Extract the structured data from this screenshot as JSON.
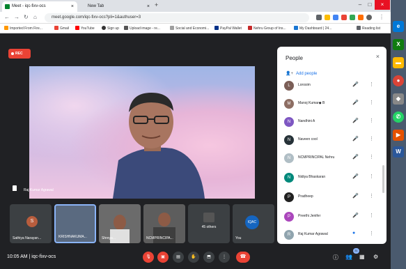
{
  "browser": {
    "tabs": [
      {
        "title": "Meet - iqc-fixv-ocs",
        "close": "×",
        "active": true
      },
      {
        "title": "New Tab",
        "close": "×",
        "active": false
      }
    ],
    "new_tab": "+",
    "window_controls": [
      "–",
      "□",
      "×"
    ],
    "url": "meet.google.com/iqc-fixv-ocs?pli=1&authuser=3",
    "bookmarks": [
      "Imported From Fire...",
      "Gmail",
      "YouTube",
      "Sign up",
      "Upload image - re...",
      "Social and Economi...",
      "PayPal Wallet",
      "Nehru Group of Ins...",
      "My Dashboard | 24...",
      "Reading list"
    ]
  },
  "meet": {
    "rec_label": "REC",
    "presenter_name": "Raj Kumar Agrawal",
    "tiles": [
      {
        "name": "Sathiya Narayan...",
        "initial": "S"
      },
      {
        "name": "KRISHNAKUMA..."
      },
      {
        "name": "Shreya..."
      },
      {
        "name": "NCMPRINCIPA..."
      },
      {
        "name": "45 others"
      },
      {
        "name": "You",
        "badge": "IQAC"
      }
    ],
    "time_meeting": "10:05 AM | iqc-fixv-ocs",
    "people_badge": "31"
  },
  "people_panel": {
    "title": "People",
    "close": "×",
    "add_people": "Add people",
    "participants": [
      {
        "name": "Lorosim",
        "initial": "L",
        "color": "#7b5e57"
      },
      {
        "name": "Manoj Kumar◆ B",
        "initial": "M",
        "color": "#8d6e63"
      },
      {
        "name": "Nandhini A",
        "initial": "N",
        "color": "#7e57c2"
      },
      {
        "name": "Naveen cool",
        "initial": "N",
        "color": "#263238"
      },
      {
        "name": "NCMPRINCIPAL Nehru",
        "initial": "N",
        "color": "#b0bec5"
      },
      {
        "name": "Nidiya Bhaskaran",
        "initial": "N",
        "color": "#00897b"
      },
      {
        "name": "Pradheep",
        "initial": "P",
        "color": "#212121"
      },
      {
        "name": "Preethi Jenifer",
        "initial": "P",
        "color": "#ab47bc"
      },
      {
        "name": "Raj Kumar Agrawal",
        "initial": "R",
        "color": "#90a4ae"
      }
    ]
  }
}
